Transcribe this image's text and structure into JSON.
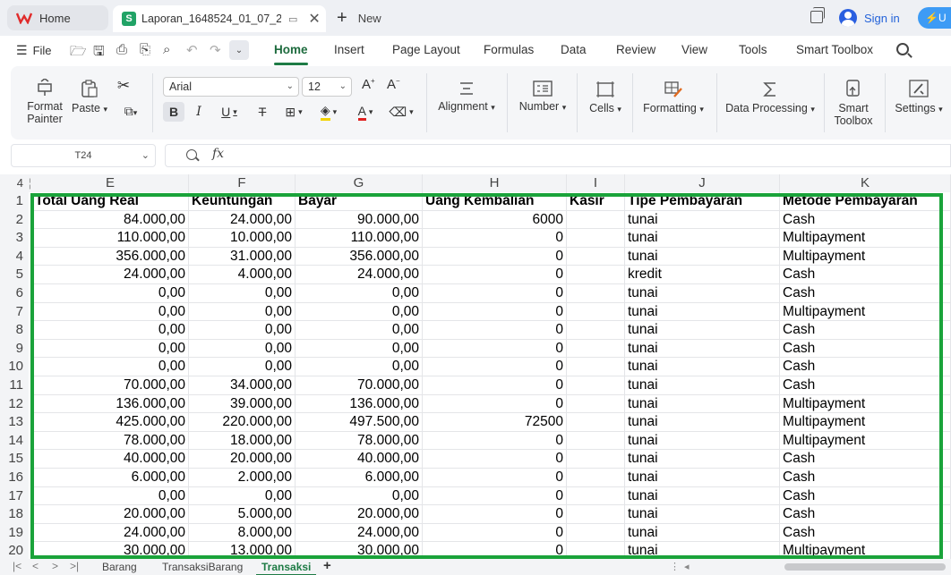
{
  "titlebar": {
    "home_tab": "Home",
    "doc_tab_title": "Laporan_1648524_01_07_2023",
    "new_label": "New",
    "signin_label": "Sign in",
    "upgrade_label": "U"
  },
  "menubar": {
    "file": "File",
    "tabs": [
      "Home",
      "Insert",
      "Page Layout",
      "Formulas",
      "Data",
      "Review",
      "View",
      "Tools",
      "Smart Toolbox"
    ],
    "active_tab": "Home",
    "accent_color": "#1e7b45"
  },
  "ribbon": {
    "format_painter": [
      "Format",
      "Painter"
    ],
    "paste": "Paste",
    "font_name": "Arial",
    "font_size": "12",
    "alignment": "Alignment",
    "number": "Number",
    "cells": "Cells",
    "formatting": "Formatting",
    "data_processing": "Data Processing",
    "smart_toolbox": [
      "Smart",
      "Toolbox"
    ],
    "settings": "Settings"
  },
  "formula_bar": {
    "name_box": "T24",
    "fx": "fx",
    "content": ""
  },
  "grid": {
    "row_numbers": [
      "4",
      "1",
      "2",
      "3",
      "4",
      "5",
      "6",
      "7",
      "8",
      "9",
      "10",
      "11",
      "12",
      "13",
      "14",
      "15",
      "16",
      "17",
      "18",
      "19",
      "20"
    ],
    "columns": [
      "E",
      "F",
      "G",
      "H",
      "I",
      "J",
      "K"
    ],
    "header_row": [
      "Total Uang Real",
      "Keuntungan",
      "Bayar",
      "Uang Kembalian",
      "Kasir",
      "Tipe Pembayaran",
      "Metode Pembayaran"
    ],
    "rows": [
      [
        "84.000,00",
        "24.000,00",
        "90.000,00",
        "6000",
        "",
        "tunai",
        "Cash"
      ],
      [
        "110.000,00",
        "10.000,00",
        "110.000,00",
        "0",
        "",
        "tunai",
        "Multipayment"
      ],
      [
        "356.000,00",
        "31.000,00",
        "356.000,00",
        "0",
        "",
        "tunai",
        "Multipayment"
      ],
      [
        "24.000,00",
        "4.000,00",
        "24.000,00",
        "0",
        "",
        "kredit",
        "Cash"
      ],
      [
        "0,00",
        "0,00",
        "0,00",
        "0",
        "",
        "tunai",
        "Cash"
      ],
      [
        "0,00",
        "0,00",
        "0,00",
        "0",
        "",
        "tunai",
        "Multipayment"
      ],
      [
        "0,00",
        "0,00",
        "0,00",
        "0",
        "",
        "tunai",
        "Cash"
      ],
      [
        "0,00",
        "0,00",
        "0,00",
        "0",
        "",
        "tunai",
        "Cash"
      ],
      [
        "0,00",
        "0,00",
        "0,00",
        "0",
        "",
        "tunai",
        "Cash"
      ],
      [
        "70.000,00",
        "34.000,00",
        "70.000,00",
        "0",
        "",
        "tunai",
        "Cash"
      ],
      [
        "136.000,00",
        "39.000,00",
        "136.000,00",
        "0",
        "",
        "tunai",
        "Multipayment"
      ],
      [
        "425.000,00",
        "220.000,00",
        "497.500,00",
        "72500",
        "",
        "tunai",
        "Multipayment"
      ],
      [
        "78.000,00",
        "18.000,00",
        "78.000,00",
        "0",
        "",
        "tunai",
        "Multipayment"
      ],
      [
        "40.000,00",
        "20.000,00",
        "40.000,00",
        "0",
        "",
        "tunai",
        "Cash"
      ],
      [
        "6.000,00",
        "2.000,00",
        "6.000,00",
        "0",
        "",
        "tunai",
        "Cash"
      ],
      [
        "0,00",
        "0,00",
        "0,00",
        "0",
        "",
        "tunai",
        "Cash"
      ],
      [
        "20.000,00",
        "5.000,00",
        "20.000,00",
        "0",
        "",
        "tunai",
        "Cash"
      ],
      [
        "24.000,00",
        "8.000,00",
        "24.000,00",
        "0",
        "",
        "tunai",
        "Cash"
      ],
      [
        "30.000,00",
        "13.000,00",
        "30.000,00",
        "0",
        "",
        "tunai",
        "Multipayment"
      ]
    ],
    "selection_color": "#1aa33a"
  },
  "sheets": {
    "tabs": [
      "Barang",
      "TransaksiBarang",
      "Transaksi"
    ],
    "active": "Transaksi"
  }
}
